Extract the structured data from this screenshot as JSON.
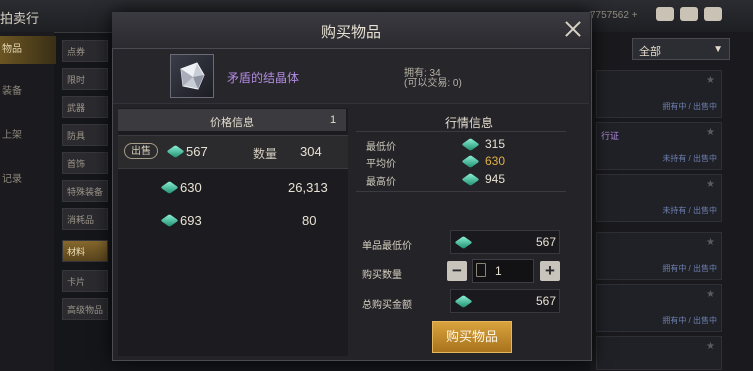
{
  "background": {
    "top_title": "拍卖行",
    "top_right_text": "7757562 +",
    "left_nav": [
      "物品",
      "装备",
      "上架",
      "记录"
    ],
    "categories": [
      "点券",
      "限时",
      "武器",
      "防具",
      "首饰",
      "特殊装备",
      "消耗品",
      "材料",
      "卡片",
      "高级物品"
    ],
    "active_category_index": 7,
    "dropdown_value": "全部",
    "list_tags": [
      "拥有中 / 出售中",
      "未持有 / 出售中",
      "未持有 / 出售中",
      "拥有中 / 出售中",
      "拥有中 / 出售中",
      "拥有中 / 出售中"
    ],
    "partial_label": "行证"
  },
  "dialog": {
    "title": "购买物品",
    "item": {
      "name": "矛盾的结晶体",
      "owned_line1": "拥有: 34",
      "owned_line2": "(可以交易: 0)"
    },
    "price_info": {
      "header": "价格信息",
      "header_count": "1",
      "sell_tag": "出售",
      "qty_label": "数量",
      "orders": [
        {
          "price": "567",
          "qty": "304"
        },
        {
          "price": "630",
          "qty": "26,313"
        },
        {
          "price": "693",
          "qty": "80"
        }
      ]
    },
    "market_info": {
      "header": "行情信息",
      "min_label": "最低价",
      "min_value": "315",
      "avg_label": "平均价",
      "avg_value": "630",
      "max_label": "最高价",
      "max_value": "945"
    },
    "form": {
      "unit_min_label": "单品最低价",
      "unit_min_value": "567",
      "buy_qty_label": "购买数量",
      "buy_qty_value": "1",
      "total_label": "总购买金额",
      "total_value": "567"
    },
    "buy_button": "购买物品"
  },
  "colors": {
    "accent_gold": "#e0b048",
    "item_purple": "#b38be0",
    "gem": "#3ecfa4"
  }
}
